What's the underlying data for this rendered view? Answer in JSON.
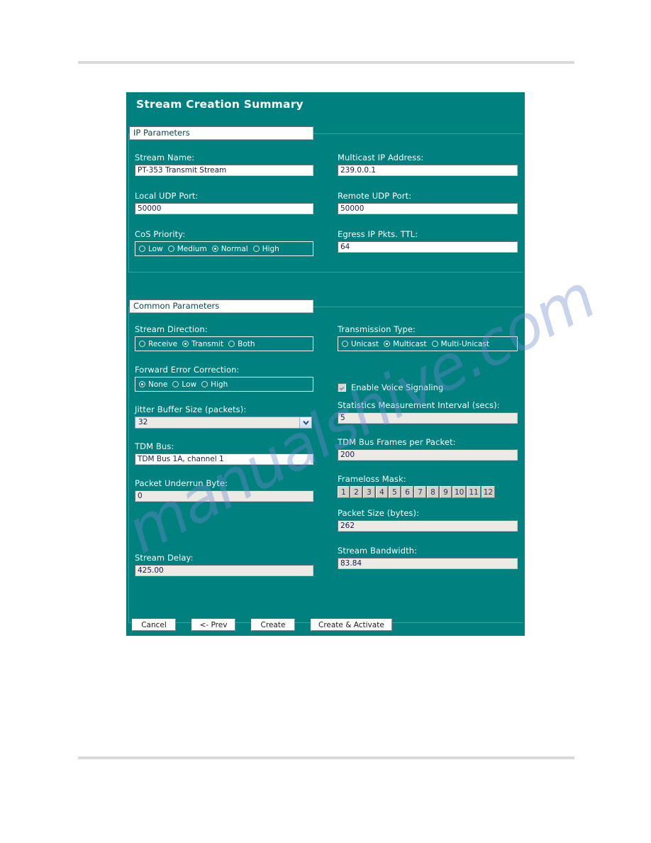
{
  "dialog": {
    "title": "Stream Creation Summary",
    "sections": {
      "ip": {
        "legend": "IP Parameters",
        "stream_name_label": "Stream Name:",
        "stream_name_value": "PT-353 Transmit Stream",
        "multicast_ip_label": "Multicast IP Address:",
        "multicast_ip_value": "239.0.0.1",
        "local_udp_label": "Local UDP Port:",
        "local_udp_value": "50000",
        "remote_udp_label": "Remote UDP Port:",
        "remote_udp_value": "50000",
        "cos_priority_label": "CoS Priority:",
        "cos_priority_options": [
          {
            "label": "Low",
            "selected": false
          },
          {
            "label": "Medium",
            "selected": false
          },
          {
            "label": "Normal",
            "selected": true
          },
          {
            "label": "High",
            "selected": false
          }
        ],
        "egress_ttl_label": "Egress IP Pkts. TTL:",
        "egress_ttl_value": "64"
      },
      "common": {
        "legend": "Common Parameters",
        "stream_direction_label": "Stream Direction:",
        "stream_direction_options": [
          {
            "label": "Receive",
            "selected": false
          },
          {
            "label": "Transmit",
            "selected": true
          },
          {
            "label": "Both",
            "selected": false
          }
        ],
        "transmission_type_label": "Transmission Type:",
        "transmission_type_options": [
          {
            "label": "Unicast",
            "selected": false
          },
          {
            "label": "Multicast",
            "selected": true
          },
          {
            "label": "Multi-Unicast",
            "selected": false
          }
        ],
        "fec_label": "Forward Error Correction:",
        "fec_options": [
          {
            "label": "None",
            "selected": true
          },
          {
            "label": "Low",
            "selected": false
          },
          {
            "label": "High",
            "selected": false
          }
        ],
        "voice_signaling_label": "Enable Voice Signaling",
        "voice_signaling_checked": true,
        "jitter_buffer_label": "Jitter Buffer Size (packets):",
        "jitter_buffer_value": "32",
        "stats_interval_label": "Statistics Measurement Interval (secs):",
        "stats_interval_value": "5",
        "tdm_bus_label": "TDM Bus:",
        "tdm_bus_value": "TDM Bus 1A, channel 1",
        "tdm_frames_label": "TDM Bus Frames per Packet:",
        "tdm_frames_value": "200",
        "underrun_byte_label": "Packet Underrun Byte:",
        "underrun_byte_value": "0",
        "frameloss_mask_label": "Frameloss Mask:",
        "frameloss_mask_cells": [
          "1",
          "2",
          "3",
          "4",
          "5",
          "6",
          "7",
          "8",
          "9",
          "10",
          "11",
          "12"
        ],
        "packet_size_label": "Packet Size (bytes):",
        "packet_size_value": "262",
        "stream_delay_label": "Stream Delay:",
        "stream_delay_value": "425.00",
        "stream_bandwidth_label": "Stream Bandwidth:",
        "stream_bandwidth_value": "83.84"
      }
    },
    "buttons": {
      "cancel": "Cancel",
      "prev": "<- Prev",
      "create": "Create",
      "create_activate": "Create & Activate"
    }
  },
  "page": {
    "watermark": "manualshive.com"
  },
  "colors": {
    "panel_teal": "#00807e",
    "legend_text": "#084a4a",
    "field_text": "#12204a",
    "label_white": "#ffffff",
    "mask_cell": "#d4d0c8"
  }
}
